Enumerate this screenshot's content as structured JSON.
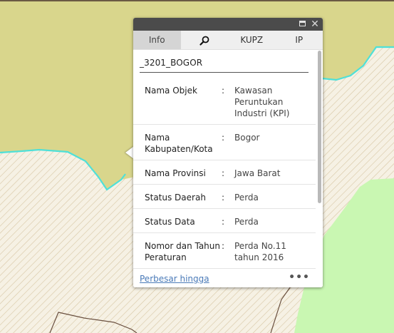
{
  "map": {
    "colors": {
      "selected_polygon_fill": "#d9d68c",
      "selected_polygon_outline": "#4fe0d8",
      "hatched_fill": "#f6f1e4",
      "hatch_line": "#d9c9a8",
      "green_zone": "#c9f7b2",
      "boundary_line": "#6a5040"
    }
  },
  "popup": {
    "maximize_icon": "maximize-icon",
    "close_icon": "close-icon",
    "tabs": [
      {
        "label": "Info",
        "active": true
      },
      {
        "label": "",
        "icon": "search-icon"
      },
      {
        "label": "KUPZ"
      },
      {
        "label": "IP"
      }
    ],
    "feature_title": "_3201_BOGOR",
    "attributes": [
      {
        "key": "Nama Objek",
        "colon": ":",
        "value": "Kawasan Peruntukan Industri (KPI)"
      },
      {
        "key": "Nama Kabupaten/Kota",
        "colon": ":",
        "value": "Bogor"
      },
      {
        "key": "Nama Provinsi",
        "colon": ":",
        "value": "Jawa Barat"
      },
      {
        "key": "Status Daerah",
        "colon": ":",
        "value": "Perda"
      },
      {
        "key": "Status Data",
        "colon": ":",
        "value": "Perda"
      },
      {
        "key": "Nomor dan Tahun Peraturan",
        "colon": ":",
        "value": "Perda No.11 tahun 2016"
      }
    ],
    "footer": {
      "zoom_link": "Perbesar hingga",
      "more": "•••"
    }
  }
}
